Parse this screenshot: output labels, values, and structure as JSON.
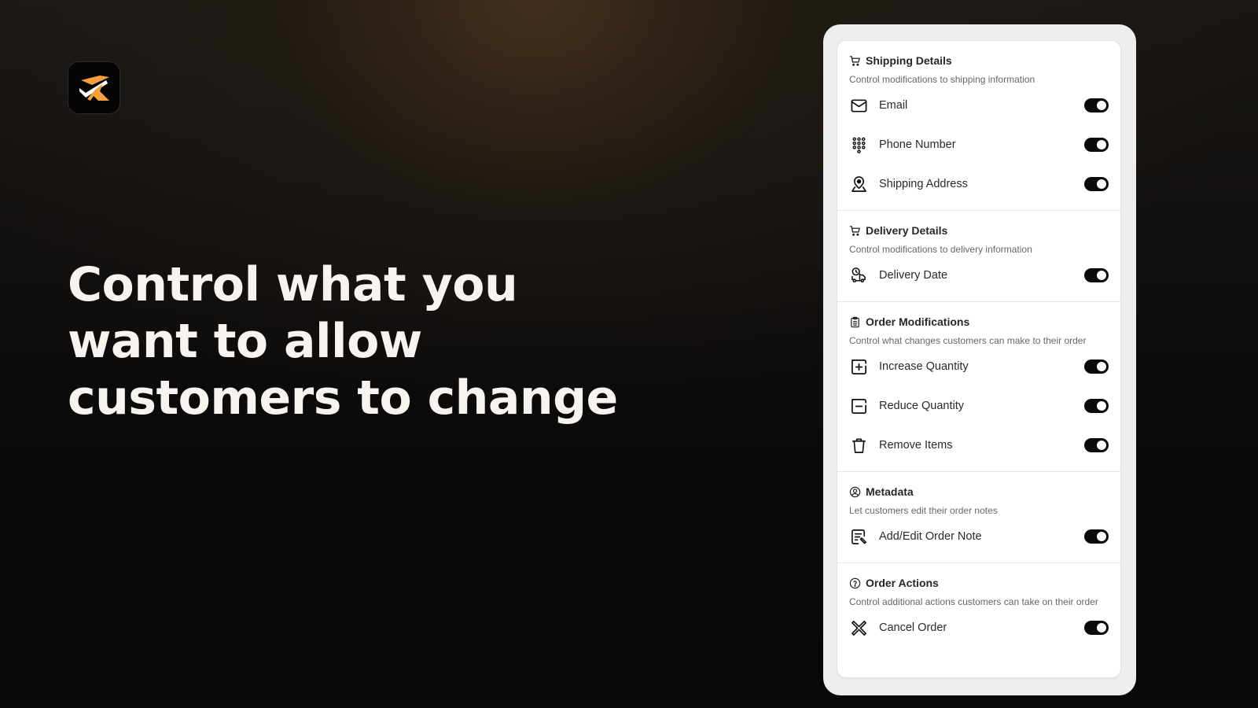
{
  "brand": {
    "logo_icon": "brand-logo-icon",
    "colors": {
      "accent": "#F5A03A",
      "check": "#FFFFFF",
      "tile": "#050505"
    }
  },
  "hero": {
    "headline_lines": [
      "Control what you",
      "want to allow",
      "customers to change"
    ]
  },
  "settings": {
    "sections": [
      {
        "title": "Shipping Details",
        "icon": "cart-icon",
        "description": "Control modifications to shipping information",
        "items": [
          {
            "label": "Email",
            "icon": "mail-icon",
            "enabled": true
          },
          {
            "label": "Phone Number",
            "icon": "dialpad-icon",
            "enabled": true
          },
          {
            "label": "Shipping Address",
            "icon": "map-pin-icon",
            "enabled": true
          }
        ]
      },
      {
        "title": "Delivery Details",
        "icon": "cart-icon",
        "description": "Control modifications to delivery information",
        "items": [
          {
            "label": "Delivery Date",
            "icon": "truck-clock-icon",
            "enabled": true
          }
        ]
      },
      {
        "title": "Order Modifications",
        "icon": "clipboard-icon",
        "description": "Control what changes customers can make to their order",
        "items": [
          {
            "label": "Increase Quantity",
            "icon": "plus-square-icon",
            "enabled": true
          },
          {
            "label": "Reduce Quantity",
            "icon": "minus-square-icon",
            "enabled": true
          },
          {
            "label": "Remove Items",
            "icon": "trash-icon",
            "enabled": true
          }
        ]
      },
      {
        "title": "Metadata",
        "icon": "user-circle-icon",
        "description": "Let customers edit their order notes",
        "items": [
          {
            "label": "Add/Edit Order Note",
            "icon": "note-edit-icon",
            "enabled": true
          }
        ]
      },
      {
        "title": "Order Actions",
        "icon": "help-circle-icon",
        "description": "Control additional actions customers can take on their order",
        "items": [
          {
            "label": "Cancel Order",
            "icon": "cancel-x-icon",
            "enabled": true
          }
        ]
      }
    ]
  }
}
